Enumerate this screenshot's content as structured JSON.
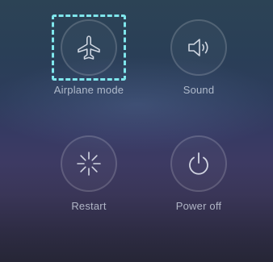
{
  "power_menu": {
    "items": [
      {
        "label": "Airplane mode",
        "icon": "airplane-icon"
      },
      {
        "label": "Sound",
        "icon": "speaker-icon"
      },
      {
        "label": "Restart",
        "icon": "restart-icon"
      },
      {
        "label": "Power off",
        "icon": "power-icon"
      }
    ],
    "highlight_color": "#7fe6ec"
  }
}
